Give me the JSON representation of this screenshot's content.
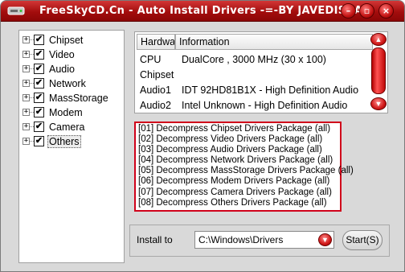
{
  "window": {
    "title": "FreeSkyCD.Cn - Auto Install Drivers -=-BY JAVEDISAAC",
    "icon": "drive-icon",
    "controls": {
      "minimize": "minimize-icon",
      "restore": "restore-icon",
      "close": "close-icon"
    },
    "colors": {
      "titlebar": "#a30d0d",
      "accent": "#d0021b",
      "body": "#d9d9d9"
    }
  },
  "tree": {
    "items": [
      {
        "label": "Chipset",
        "checked": true,
        "expander": "+"
      },
      {
        "label": "Video",
        "checked": true,
        "expander": "+"
      },
      {
        "label": "Audio",
        "checked": true,
        "expander": "+"
      },
      {
        "label": "Network",
        "checked": true,
        "expander": "+"
      },
      {
        "label": "MassStorage",
        "checked": true,
        "expander": "+"
      },
      {
        "label": "Modem",
        "checked": true,
        "expander": "+"
      },
      {
        "label": "Camera",
        "checked": true,
        "expander": "+"
      },
      {
        "label": "Others",
        "checked": true,
        "expander": "+",
        "selected": true
      }
    ]
  },
  "info": {
    "columns": [
      "Hardwa",
      "Information"
    ],
    "rows": [
      [
        "CPU",
        "DualCore , 3000 MHz (30 x 100)"
      ],
      [
        "Chipset",
        ""
      ],
      [
        "Audio1",
        "IDT 92HD81B1X  - High Definition Audio"
      ],
      [
        "Audio2",
        "Intel Unknown  - High Definition Audio"
      ]
    ]
  },
  "log": {
    "lines": [
      "[01] Decompress Chipset Drivers Package (all)",
      "[02] Decompress Video Drivers Package (all)",
      "[03] Decompress Audio Drivers Package (all)",
      "[04] Decompress Network Drivers Package (all)",
      "[05] Decompress MassStorage Drivers Package (all)",
      "[06] Decompress Modem Drivers Package (all)",
      "[07] Decompress Camera Drivers Package (all)",
      "[08] Decompress Others Drivers Package (all)"
    ]
  },
  "install": {
    "label": "Install to",
    "path": "C:\\Windows\\Drivers",
    "start_label": "Start(S)"
  }
}
